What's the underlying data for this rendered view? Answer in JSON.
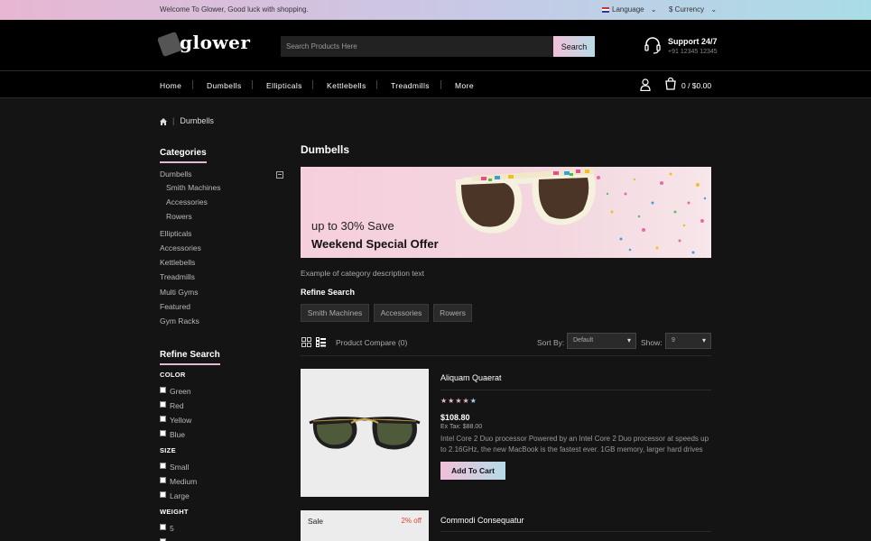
{
  "topbar": {
    "welcome": "Welcome To Glower, Good luck with shopping.",
    "language": "Language",
    "currency": "$ Currency"
  },
  "header": {
    "logo_text": "glower",
    "search_placeholder": "Search Products Here",
    "search_button": "Search",
    "support_title": "Support 24/7",
    "support_phone": "+91 12345 12345"
  },
  "nav": {
    "items": [
      "Home",
      "Dumbells",
      "Ellipticals",
      "Kettlebells",
      "Treadmills",
      "More"
    ],
    "cart": "0 / $0.00"
  },
  "breadcrumb": {
    "current": "Dumbells"
  },
  "sidebar": {
    "categories_title": "Categories",
    "categories": [
      {
        "label": "Dumbells"
      },
      {
        "label": "Smith Machines"
      },
      {
        "label": "Accessories"
      },
      {
        "label": "Rowers"
      },
      {
        "label": "Ellipticals"
      },
      {
        "label": "Accessories"
      },
      {
        "label": "Kettlebells"
      },
      {
        "label": "Treadmills"
      },
      {
        "label": "Multi Gyms"
      },
      {
        "label": "Featured"
      },
      {
        "label": "Gym Racks"
      }
    ],
    "refine_title": "Refine Search",
    "color_head": "COLOR",
    "colors": [
      "Green",
      "Red",
      "Yellow",
      "Blue"
    ],
    "size_head": "SIZE",
    "sizes": [
      "Small",
      "Medium",
      "Large"
    ],
    "weight_head": "WEIGHT",
    "weights": [
      "5"
    ]
  },
  "main": {
    "title": "Dumbells",
    "banner_sub": "up to 30% Save",
    "banner_main": "Weekend Special Offer",
    "description": "Example of category description text",
    "refine_title": "Refine Search",
    "refine_tags": [
      "Smith Machines",
      "Accessories",
      "Rowers"
    ],
    "compare": "Product Compare (0)",
    "sort_label": "Sort By:",
    "sort_value": "Default",
    "show_label": "Show:",
    "show_value": "9"
  },
  "products": [
    {
      "name": "Aliquam Quaerat",
      "rating": 4,
      "price": "$108.80",
      "ex_tax": "Ex Tax: $88.00",
      "desc": "Intel Core 2 Duo processor Powered by an Intel Core 2 Duo processor at speeds up to 2.16GHz, the new MacBook is the fastest ever. 1GB memory, larger hard drives T...",
      "add_to_cart": "Add To Cart"
    },
    {
      "name": "Commodi Consequatur",
      "sale": "Sale",
      "discount": "2% off"
    }
  ],
  "colors": {
    "accent_pink": "#f0c0d8",
    "accent_blue": "#b6dbe8",
    "background": "#141414"
  }
}
